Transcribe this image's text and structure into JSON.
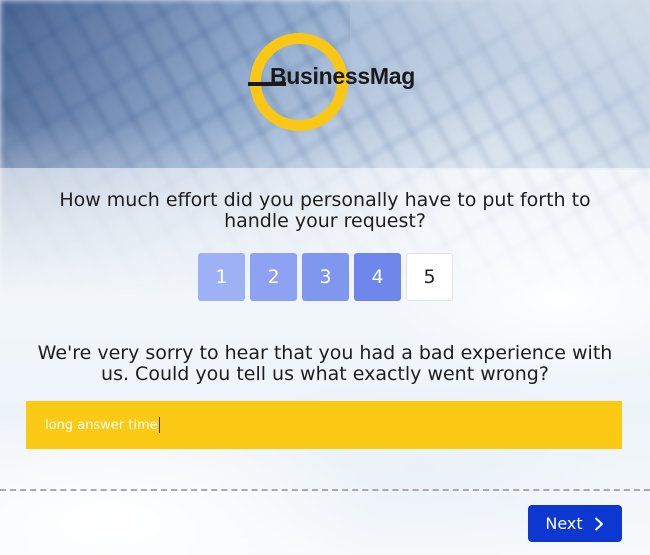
{
  "brand": {
    "logo_text": "BusinessMag",
    "accent_color": "#fac814"
  },
  "survey": {
    "question": "How much effort did you personally have to put forth to handle your request?",
    "rating": {
      "options": [
        "1",
        "2",
        "3",
        "4",
        "5"
      ],
      "selected": "5"
    },
    "followup_question": "We're very sorry to hear that you had a bad experience with us. Could you tell us what exactly went wrong?",
    "answer": {
      "value": "long answer time",
      "field_color": "#fcc914"
    }
  },
  "navigation": {
    "next_label": "Next",
    "next_icon": "chevron-right-icon",
    "button_color": "#0c37d0"
  }
}
